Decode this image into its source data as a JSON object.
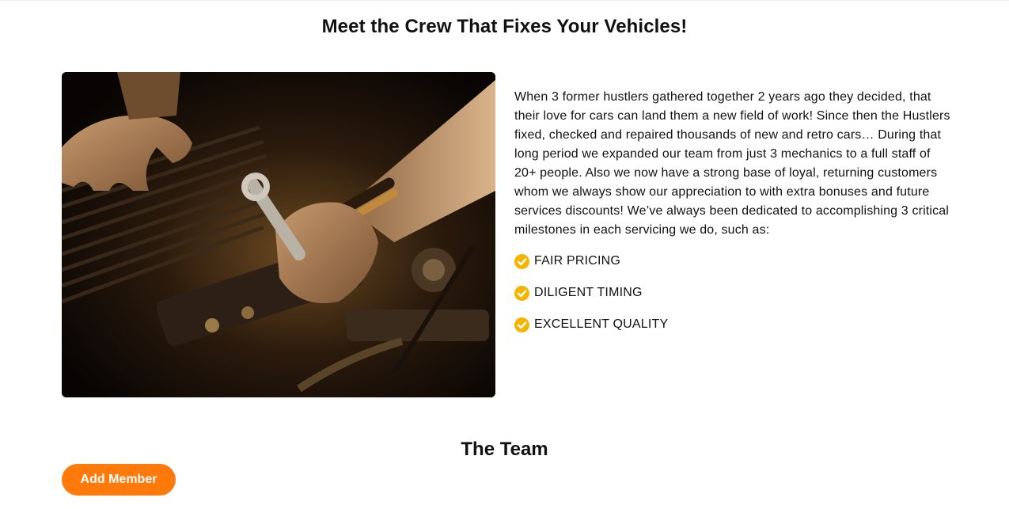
{
  "about": {
    "heading": "Meet the Crew That Fixes Your Vehicles!",
    "paragraph": "When 3 former hustlers gathered together 2 years ago they decided, that their love for cars can land them a new field of work! Since then the Hustlers fixed, checked and repaired thousands of new and retro cars… During that long period we expanded our team from just 3 mechanics to a full staff of 20+ people. Also we now have a strong base of loyal, returning customers whom we always show our appreciation to with extra bonuses and future services discounts! We’ve always been dedicated to accomplishing 3 critical milestones in each servicing we do, such as:",
    "milestones": [
      "FAIR PRICING",
      "DILIGENT TIMING",
      "EXCELLENT QUALITY"
    ],
    "image_icon": "mechanic-photo"
  },
  "team": {
    "heading": "The Team",
    "add_button_label": "Add Member"
  },
  "colors": {
    "accent": "#ff7a0a",
    "check": "#f5b400",
    "text": "#111111"
  }
}
